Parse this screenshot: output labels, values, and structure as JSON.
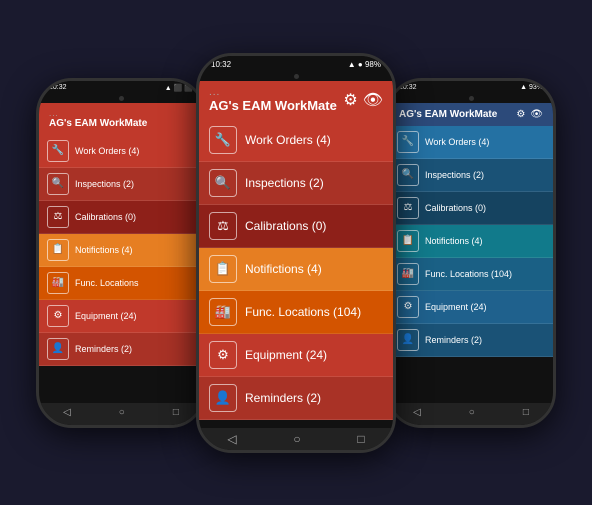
{
  "app": {
    "title": "AG's EAM WorkMate",
    "status_time": "10:32",
    "signal": "●●●",
    "battery": "98%",
    "icons": {
      "settings": "⚙",
      "eye": "👁",
      "three_dots": "..."
    }
  },
  "menu_items": [
    {
      "label": "Work Orders (4)",
      "icon": "🔧",
      "color_class": "item-work-orders",
      "blue_class": "blue-work-orders"
    },
    {
      "label": "Inspections (2)",
      "icon": "🔍",
      "color_class": "item-inspections",
      "blue_class": "blue-inspections"
    },
    {
      "label": "Calibrations (0)",
      "icon": "⚖",
      "color_class": "item-calibrations",
      "blue_class": "blue-calibrations"
    },
    {
      "label": "Notifictions (4)",
      "icon": "📋",
      "color_class": "item-notifictions",
      "blue_class": "blue-notifictions"
    },
    {
      "label": "Func. Locations (104)",
      "icon": "🏭",
      "color_class": "item-func-loc",
      "blue_class": "blue-func-loc"
    },
    {
      "label": "Equipment (24)",
      "icon": "⚙",
      "color_class": "item-equipment",
      "blue_class": "blue-equipment"
    },
    {
      "label": "Reminders (2)",
      "icon": "👤",
      "color_class": "item-reminders",
      "blue_class": "blue-reminders"
    }
  ]
}
